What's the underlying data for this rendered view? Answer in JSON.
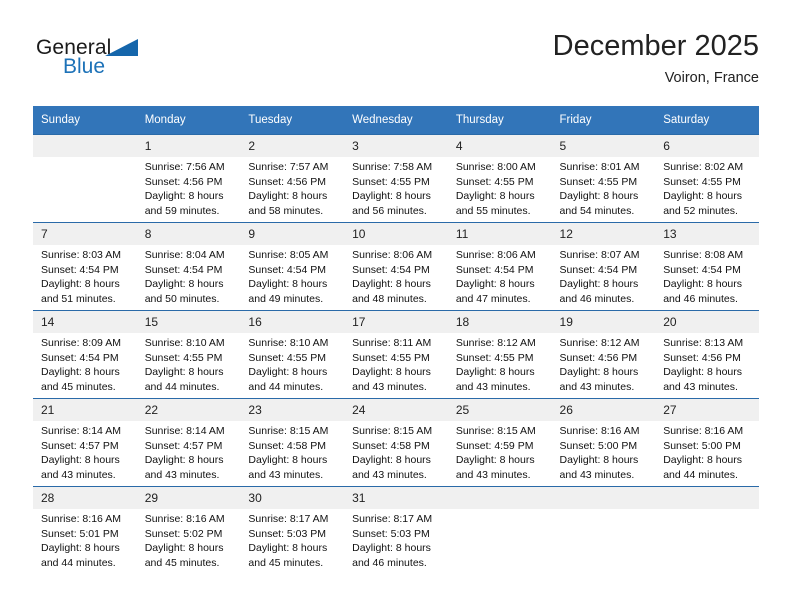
{
  "brand": {
    "name_part1": "General",
    "name_part2": "Blue",
    "accent_color": "#1566ab"
  },
  "header": {
    "title": "December 2025",
    "location": "Voiron, France"
  },
  "calendar": {
    "header_bg": "#3275b9",
    "daynum_bg": "#f0f0f0",
    "weekday_headers": [
      "Sunday",
      "Monday",
      "Tuesday",
      "Wednesday",
      "Thursday",
      "Friday",
      "Saturday"
    ],
    "weeks": [
      [
        {
          "day": "",
          "sunrise": "",
          "sunset": "",
          "daylight1": "",
          "daylight2": ""
        },
        {
          "day": "1",
          "sunrise": "Sunrise: 7:56 AM",
          "sunset": "Sunset: 4:56 PM",
          "daylight1": "Daylight: 8 hours",
          "daylight2": "and 59 minutes."
        },
        {
          "day": "2",
          "sunrise": "Sunrise: 7:57 AM",
          "sunset": "Sunset: 4:56 PM",
          "daylight1": "Daylight: 8 hours",
          "daylight2": "and 58 minutes."
        },
        {
          "day": "3",
          "sunrise": "Sunrise: 7:58 AM",
          "sunset": "Sunset: 4:55 PM",
          "daylight1": "Daylight: 8 hours",
          "daylight2": "and 56 minutes."
        },
        {
          "day": "4",
          "sunrise": "Sunrise: 8:00 AM",
          "sunset": "Sunset: 4:55 PM",
          "daylight1": "Daylight: 8 hours",
          "daylight2": "and 55 minutes."
        },
        {
          "day": "5",
          "sunrise": "Sunrise: 8:01 AM",
          "sunset": "Sunset: 4:55 PM",
          "daylight1": "Daylight: 8 hours",
          "daylight2": "and 54 minutes."
        },
        {
          "day": "6",
          "sunrise": "Sunrise: 8:02 AM",
          "sunset": "Sunset: 4:55 PM",
          "daylight1": "Daylight: 8 hours",
          "daylight2": "and 52 minutes."
        }
      ],
      [
        {
          "day": "7",
          "sunrise": "Sunrise: 8:03 AM",
          "sunset": "Sunset: 4:54 PM",
          "daylight1": "Daylight: 8 hours",
          "daylight2": "and 51 minutes."
        },
        {
          "day": "8",
          "sunrise": "Sunrise: 8:04 AM",
          "sunset": "Sunset: 4:54 PM",
          "daylight1": "Daylight: 8 hours",
          "daylight2": "and 50 minutes."
        },
        {
          "day": "9",
          "sunrise": "Sunrise: 8:05 AM",
          "sunset": "Sunset: 4:54 PM",
          "daylight1": "Daylight: 8 hours",
          "daylight2": "and 49 minutes."
        },
        {
          "day": "10",
          "sunrise": "Sunrise: 8:06 AM",
          "sunset": "Sunset: 4:54 PM",
          "daylight1": "Daylight: 8 hours",
          "daylight2": "and 48 minutes."
        },
        {
          "day": "11",
          "sunrise": "Sunrise: 8:06 AM",
          "sunset": "Sunset: 4:54 PM",
          "daylight1": "Daylight: 8 hours",
          "daylight2": "and 47 minutes."
        },
        {
          "day": "12",
          "sunrise": "Sunrise: 8:07 AM",
          "sunset": "Sunset: 4:54 PM",
          "daylight1": "Daylight: 8 hours",
          "daylight2": "and 46 minutes."
        },
        {
          "day": "13",
          "sunrise": "Sunrise: 8:08 AM",
          "sunset": "Sunset: 4:54 PM",
          "daylight1": "Daylight: 8 hours",
          "daylight2": "and 46 minutes."
        }
      ],
      [
        {
          "day": "14",
          "sunrise": "Sunrise: 8:09 AM",
          "sunset": "Sunset: 4:54 PM",
          "daylight1": "Daylight: 8 hours",
          "daylight2": "and 45 minutes."
        },
        {
          "day": "15",
          "sunrise": "Sunrise: 8:10 AM",
          "sunset": "Sunset: 4:55 PM",
          "daylight1": "Daylight: 8 hours",
          "daylight2": "and 44 minutes."
        },
        {
          "day": "16",
          "sunrise": "Sunrise: 8:10 AM",
          "sunset": "Sunset: 4:55 PM",
          "daylight1": "Daylight: 8 hours",
          "daylight2": "and 44 minutes."
        },
        {
          "day": "17",
          "sunrise": "Sunrise: 8:11 AM",
          "sunset": "Sunset: 4:55 PM",
          "daylight1": "Daylight: 8 hours",
          "daylight2": "and 43 minutes."
        },
        {
          "day": "18",
          "sunrise": "Sunrise: 8:12 AM",
          "sunset": "Sunset: 4:55 PM",
          "daylight1": "Daylight: 8 hours",
          "daylight2": "and 43 minutes."
        },
        {
          "day": "19",
          "sunrise": "Sunrise: 8:12 AM",
          "sunset": "Sunset: 4:56 PM",
          "daylight1": "Daylight: 8 hours",
          "daylight2": "and 43 minutes."
        },
        {
          "day": "20",
          "sunrise": "Sunrise: 8:13 AM",
          "sunset": "Sunset: 4:56 PM",
          "daylight1": "Daylight: 8 hours",
          "daylight2": "and 43 minutes."
        }
      ],
      [
        {
          "day": "21",
          "sunrise": "Sunrise: 8:14 AM",
          "sunset": "Sunset: 4:57 PM",
          "daylight1": "Daylight: 8 hours",
          "daylight2": "and 43 minutes."
        },
        {
          "day": "22",
          "sunrise": "Sunrise: 8:14 AM",
          "sunset": "Sunset: 4:57 PM",
          "daylight1": "Daylight: 8 hours",
          "daylight2": "and 43 minutes."
        },
        {
          "day": "23",
          "sunrise": "Sunrise: 8:15 AM",
          "sunset": "Sunset: 4:58 PM",
          "daylight1": "Daylight: 8 hours",
          "daylight2": "and 43 minutes."
        },
        {
          "day": "24",
          "sunrise": "Sunrise: 8:15 AM",
          "sunset": "Sunset: 4:58 PM",
          "daylight1": "Daylight: 8 hours",
          "daylight2": "and 43 minutes."
        },
        {
          "day": "25",
          "sunrise": "Sunrise: 8:15 AM",
          "sunset": "Sunset: 4:59 PM",
          "daylight1": "Daylight: 8 hours",
          "daylight2": "and 43 minutes."
        },
        {
          "day": "26",
          "sunrise": "Sunrise: 8:16 AM",
          "sunset": "Sunset: 5:00 PM",
          "daylight1": "Daylight: 8 hours",
          "daylight2": "and 43 minutes."
        },
        {
          "day": "27",
          "sunrise": "Sunrise: 8:16 AM",
          "sunset": "Sunset: 5:00 PM",
          "daylight1": "Daylight: 8 hours",
          "daylight2": "and 44 minutes."
        }
      ],
      [
        {
          "day": "28",
          "sunrise": "Sunrise: 8:16 AM",
          "sunset": "Sunset: 5:01 PM",
          "daylight1": "Daylight: 8 hours",
          "daylight2": "and 44 minutes."
        },
        {
          "day": "29",
          "sunrise": "Sunrise: 8:16 AM",
          "sunset": "Sunset: 5:02 PM",
          "daylight1": "Daylight: 8 hours",
          "daylight2": "and 45 minutes."
        },
        {
          "day": "30",
          "sunrise": "Sunrise: 8:17 AM",
          "sunset": "Sunset: 5:03 PM",
          "daylight1": "Daylight: 8 hours",
          "daylight2": "and 45 minutes."
        },
        {
          "day": "31",
          "sunrise": "Sunrise: 8:17 AM",
          "sunset": "Sunset: 5:03 PM",
          "daylight1": "Daylight: 8 hours",
          "daylight2": "and 46 minutes."
        },
        {
          "day": "",
          "sunrise": "",
          "sunset": "",
          "daylight1": "",
          "daylight2": ""
        },
        {
          "day": "",
          "sunrise": "",
          "sunset": "",
          "daylight1": "",
          "daylight2": ""
        },
        {
          "day": "",
          "sunrise": "",
          "sunset": "",
          "daylight1": "",
          "daylight2": ""
        }
      ]
    ]
  }
}
